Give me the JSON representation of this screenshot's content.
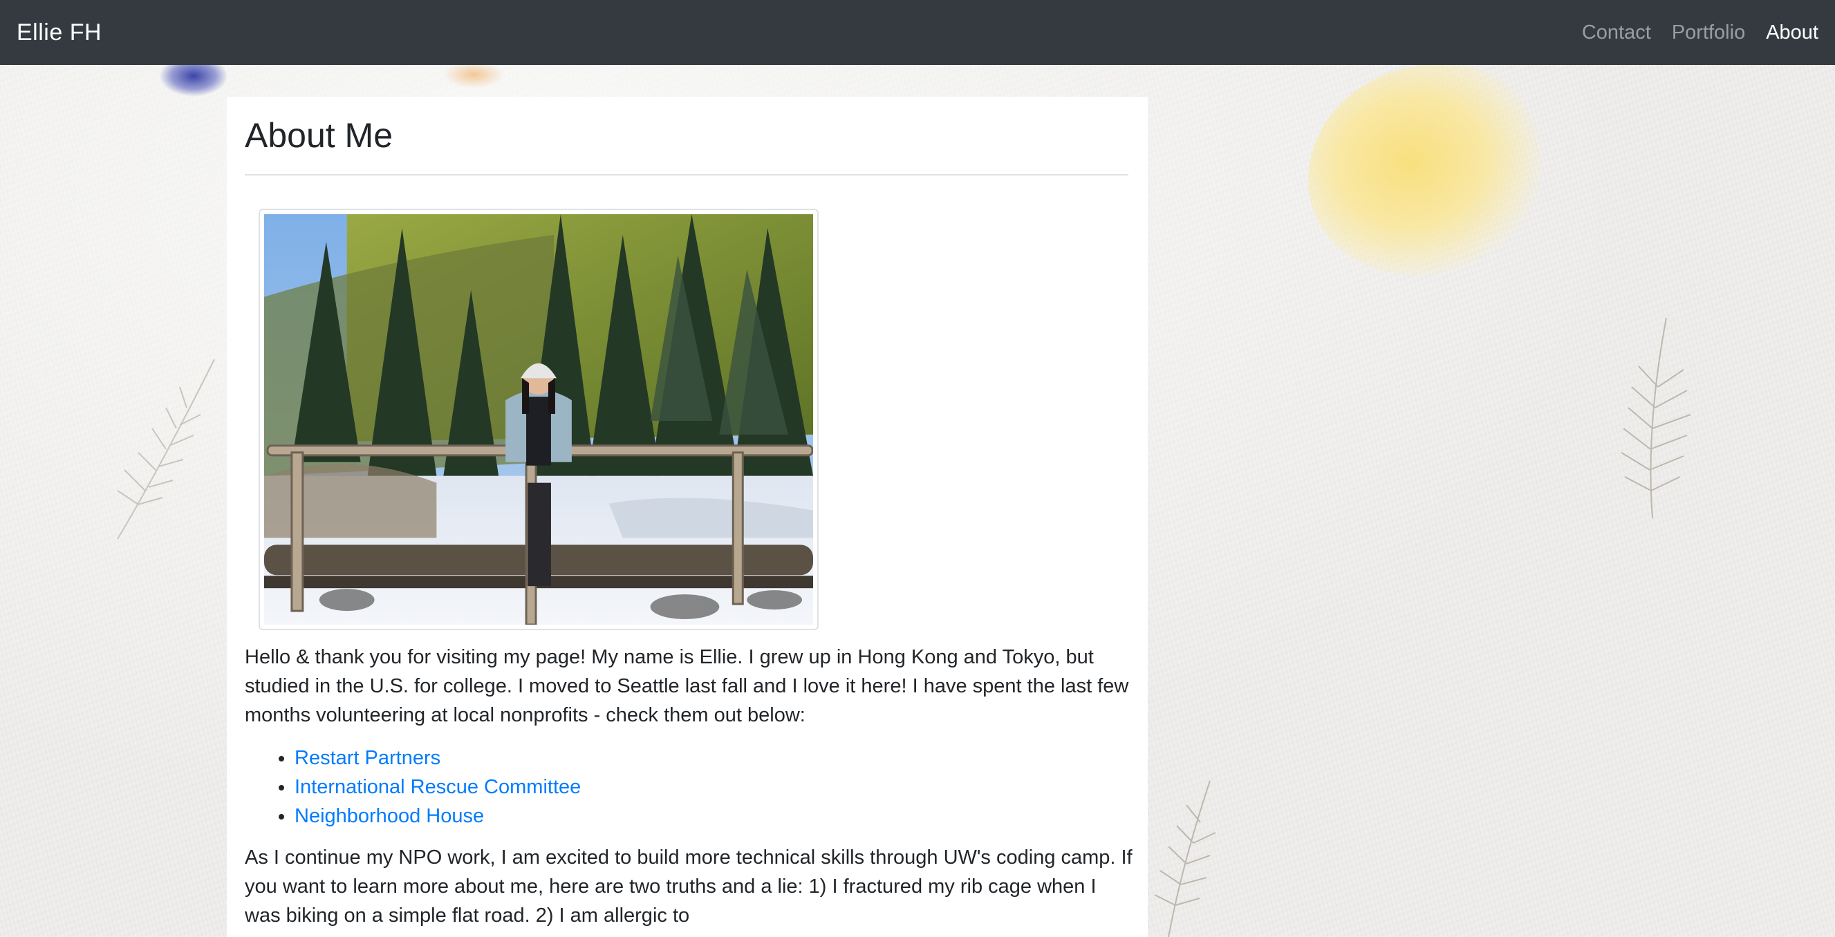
{
  "navbar": {
    "brand": "Ellie FH",
    "links": [
      {
        "label": "Contact",
        "active": false
      },
      {
        "label": "Portfolio",
        "active": false
      },
      {
        "label": "About",
        "active": true
      }
    ]
  },
  "main": {
    "title": "About Me",
    "photo_alt": "Ellie standing on a log bridge over a snowy creek in a pine forest",
    "intro": "Hello & thank you for visiting my page! My name is Ellie. I grew up in Hong Kong and Tokyo, but studied in the U.S. for college. I moved to Seattle last fall and I love it here! I have spent the last few months volunteering at local nonprofits - check them out below:",
    "organizations": [
      "Restart Partners",
      "International Rescue Committee",
      "Neighborhood House"
    ],
    "closing": "As I continue my NPO work, I am excited to build more technical skills through UW's coding camp. If you want to learn more about me, here are two truths and a lie: 1) I fractured my rib cage when I was biking on a simple flat road. 2) I am allergic to"
  },
  "colors": {
    "navbar_bg": "#343a40",
    "link": "#007bff",
    "text": "#212529"
  }
}
